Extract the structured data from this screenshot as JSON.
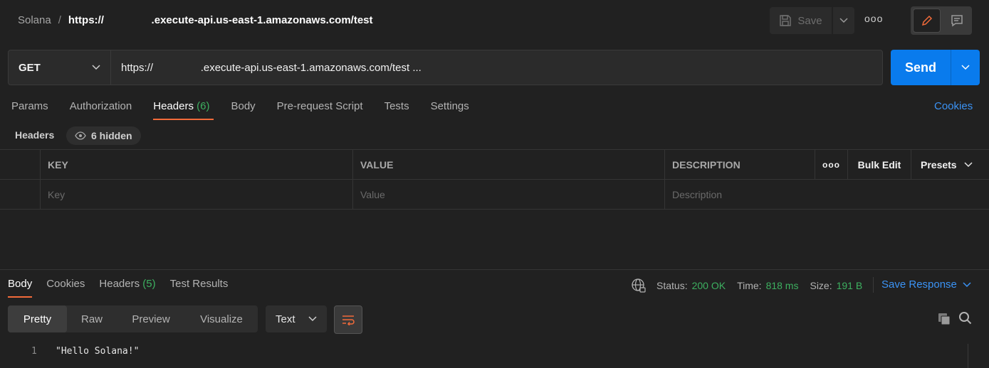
{
  "breadcrumb": {
    "parent": "Solana",
    "separator": "/",
    "url": "https://                .execute-api.us-east-1.amazonaws.com/test"
  },
  "toolbar": {
    "save_label": "Save",
    "more_label": "ooo"
  },
  "request": {
    "method": "GET",
    "url": "https://                .execute-api.us-east-1.amazonaws.com/test ...",
    "send_label": "Send"
  },
  "request_tabs": [
    {
      "label": "Params"
    },
    {
      "label": "Authorization"
    },
    {
      "label": "Headers",
      "count": "(6)"
    },
    {
      "label": "Body"
    },
    {
      "label": "Pre-request Script"
    },
    {
      "label": "Tests"
    },
    {
      "label": "Settings"
    }
  ],
  "cookies_link": "Cookies",
  "headers_section": {
    "title": "Headers",
    "hidden_label": "6 hidden"
  },
  "headers_table": {
    "columns": [
      "KEY",
      "VALUE",
      "DESCRIPTION"
    ],
    "more_label": "ooo",
    "bulk_edit": "Bulk Edit",
    "presets": "Presets",
    "placeholders": {
      "key": "Key",
      "value": "Value",
      "description": "Description"
    }
  },
  "response_tabs": [
    {
      "label": "Body"
    },
    {
      "label": "Cookies"
    },
    {
      "label": "Headers",
      "count": "(5)"
    },
    {
      "label": "Test Results"
    }
  ],
  "response_status": {
    "status_label": "Status:",
    "status_value": "200 OK",
    "time_label": "Time:",
    "time_value": "818 ms",
    "size_label": "Size:",
    "size_value": "191 B",
    "save_response": "Save Response"
  },
  "view_modes": [
    "Pretty",
    "Raw",
    "Preview",
    "Visualize"
  ],
  "format": "Text",
  "code_lines": [
    {
      "num": "1",
      "text": "\"Hello Solana!\""
    }
  ],
  "colors": {
    "accent": "#f26b3a",
    "send": "#097bed",
    "link": "#3b93f5",
    "success": "#3db060"
  }
}
